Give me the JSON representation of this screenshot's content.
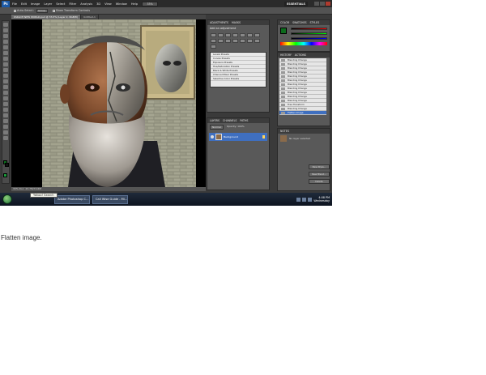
{
  "menubar": {
    "logo": "Ps",
    "items": [
      "File",
      "Edit",
      "Image",
      "Layer",
      "Select",
      "Filter",
      "Analysis",
      "3D",
      "View",
      "Window",
      "Help"
    ],
    "zoom": "33%",
    "workspace": "ESSENTIALS"
  },
  "options": {
    "auto_select": "Auto-Select:",
    "group": "Group",
    "show_transform": "Show Transform Controls"
  },
  "document_tabs": [
    "KSKLOH NEW WORLD.psd @ 33.3% (Layer 2, RGB/8)",
    "Untitled-1"
  ],
  "status_bar": "33%    Doc: 23.7M/72.6M",
  "panels": {
    "adjustments": {
      "tabs": [
        "ADJUSTMENTS",
        "MASKS"
      ],
      "title": "Add an adjustment",
      "presets": [
        "Levels Presets",
        "Curves Presets",
        "Exposure Presets",
        "Hue/Saturation Presets",
        "Black & White Presets",
        "Channel Mixer Presets",
        "Selective Color Presets"
      ]
    },
    "layers": {
      "tabs": [
        "LAYERS",
        "CHANNELS",
        "PATHS"
      ],
      "mode": "Normal",
      "opacity": "Opacity: 100%",
      "layer_name": "Background"
    },
    "color": {
      "tabs": [
        "COLOR",
        "SWATCHES",
        "STYLES"
      ]
    },
    "history": {
      "tabs": [
        "HISTORY",
        "ACTIONS"
      ],
      "items": [
        "Blending Change",
        "Blending Change",
        "Blending Change",
        "Blending Change",
        "Blending Change",
        "Blending Change",
        "Blending Change",
        "Blending Change",
        "Blending Change",
        "Blending Change",
        "Blending Change",
        "Free Transform",
        "Blending Change",
        "Flatten Image"
      ]
    },
    "notes": {
      "tabs": [
        "NOTES"
      ],
      "label": "No layer selected",
      "buttons": [
        "New Style...",
        "New Blend...",
        "Delete"
      ]
    }
  },
  "taskbar": {
    "tooltip": "Yahoo! Search",
    "buttons": [
      "Adobe Photoshop C...",
      "Call Wise Guide - Mi..."
    ],
    "time": "4:08 PM",
    "day": "Wednesday"
  },
  "caption": "Flatten image.",
  "colors": {
    "accent": "#3f6fbf",
    "panel": "#595959",
    "taskbar": "#0d1420"
  }
}
